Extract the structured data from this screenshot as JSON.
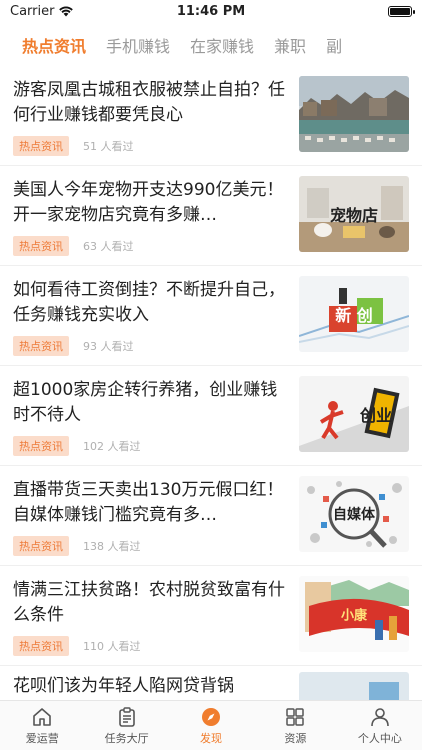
{
  "status": {
    "carrier": "Carrier",
    "time": "11:46 PM",
    "battery_level": 1.0
  },
  "tabs": [
    "热点资讯",
    "手机赚钱",
    "在家赚钱",
    "兼职",
    "副"
  ],
  "active_tab": 0,
  "items": [
    {
      "title": "游客凤凰古城租衣服被禁止自拍？任何行业赚钱都要凭良心",
      "tag": "热点资讯",
      "views": "51 人看过",
      "thumb": "scenic-town-photo"
    },
    {
      "title": "美国人今年宠物开支达990亿美元！开一家宠物店究竟有多赚…",
      "tag": "热点资讯",
      "views": "63 人看过",
      "thumb": "pet-shop-photo",
      "thumb_text": "宠物店"
    },
    {
      "title": "如何看待工资倒挂？不断提升自己，任务赚钱充实收入",
      "tag": "热点资讯",
      "views": "93 人看过",
      "thumb": "blocks-photo",
      "thumb_text": "新 创"
    },
    {
      "title": "超1000家房企转行养猪，创业赚钱时不待人",
      "tag": "热点资讯",
      "views": "102 人看过",
      "thumb": "startup-illustration",
      "thumb_text": "创业"
    },
    {
      "title": "直播带货三天卖出130万元假口红！自媒体赚钱门槛究竟有多…",
      "tag": "热点资讯",
      "views": "138 人看过",
      "thumb": "we-media-illustration",
      "thumb_text": "自媒体"
    },
    {
      "title": "情满三江扶贫路！农村脱贫致富有什么条件",
      "tag": "热点资讯",
      "views": "110 人看过",
      "thumb": "poverty-alleviation-illustration",
      "thumb_text": "小康"
    },
    {
      "title": "花呗们该为年轻人陷网贷背锅"
    }
  ],
  "nav": [
    {
      "label": "爱运营",
      "icon": "home-icon"
    },
    {
      "label": "任务大厅",
      "icon": "clipboard-icon"
    },
    {
      "label": "发现",
      "icon": "compass-icon"
    },
    {
      "label": "资源",
      "icon": "grid-icon"
    },
    {
      "label": "个人中心",
      "icon": "person-icon"
    }
  ],
  "active_nav": 2,
  "colors": {
    "accent": "#f07d2e",
    "tag_bg": "#fbdcca",
    "muted": "#b0b0b0"
  }
}
